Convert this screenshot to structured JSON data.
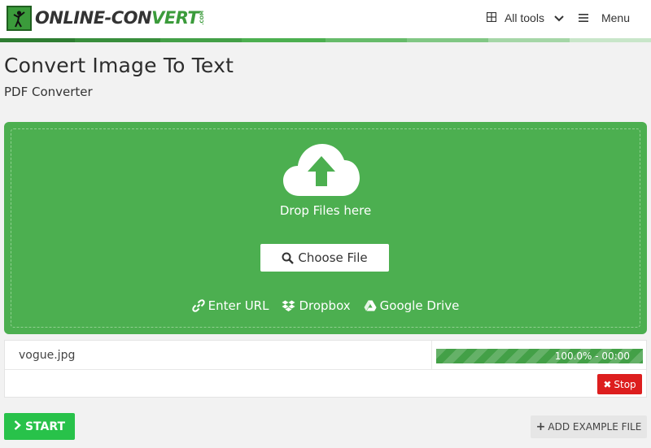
{
  "brand": {
    "name_dark_1": "ONLINE-",
    "name_dark_2": "CON",
    "name_green": "VERT",
    "suffix": ".COM"
  },
  "nav": {
    "all_tools": "All tools",
    "menu": "Menu"
  },
  "page": {
    "title": "Convert Image To Text",
    "subtitle": "PDF Converter"
  },
  "upload": {
    "drop_text": "Drop Files here",
    "choose_label": "Choose File",
    "sources": [
      {
        "label": "Enter URL",
        "icon": "link-icon"
      },
      {
        "label": "Dropbox",
        "icon": "dropbox-icon"
      },
      {
        "label": "Google Drive",
        "icon": "google-drive-icon"
      }
    ]
  },
  "file": {
    "name": "vogue.jpg",
    "progress_text": "100.0% - 00:00",
    "progress_fraction": 1.0,
    "stop_label": "Stop"
  },
  "actions": {
    "start_label": "START",
    "example_label": "ADD EXAMPLE FILE"
  },
  "colors": {
    "accent_green": "#4caf50",
    "start_green": "#28c24a",
    "stop_red": "#dd1e1e"
  }
}
